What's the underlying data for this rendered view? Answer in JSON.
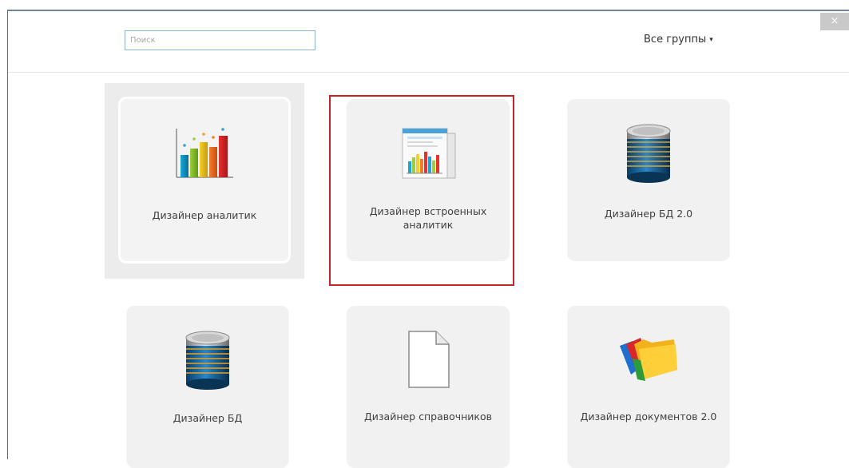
{
  "window": {
    "close_label": "×"
  },
  "search": {
    "placeholder": "Поиск"
  },
  "groups": {
    "label": "Все группы",
    "caret": "▾"
  },
  "tiles": [
    {
      "label": "Дизайнер аналитик",
      "icon": "bar-chart-icon"
    },
    {
      "label": "Дизайнер встроенных аналитик",
      "icon": "embedded-chart-document-icon"
    },
    {
      "label": "Дизайнер БД 2.0",
      "icon": "database-icon"
    },
    {
      "label": "Дизайнер БД",
      "icon": "database-icon"
    },
    {
      "label": "Дизайнер справочников",
      "icon": "blank-document-icon"
    },
    {
      "label": "Дизайнер документов 2.0",
      "icon": "folders-icon"
    }
  ]
}
